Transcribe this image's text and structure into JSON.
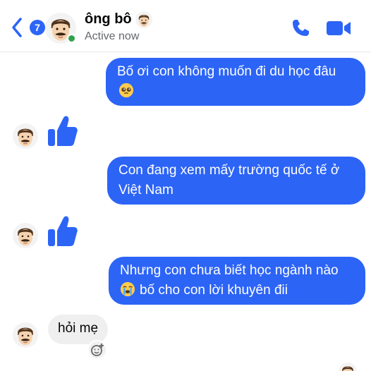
{
  "header": {
    "back_count": "7",
    "contact_name": "ông bô",
    "status": "Active now",
    "icons": {
      "back": "chevron-left-icon",
      "call": "phone-icon",
      "video": "video-camera-icon"
    }
  },
  "messages": [
    {
      "direction": "outgoing",
      "lines": [
        "Bố ơi con không muốn đi du học đâu",
        ""
      ],
      "emoji": "pleading-face-emoji"
    },
    {
      "direction": "incoming",
      "type": "like",
      "icon": "thumbs-up-icon"
    },
    {
      "direction": "outgoing",
      "lines": [
        "Con đang xem mấy trường quốc tế ở",
        "Việt Nam"
      ]
    },
    {
      "direction": "incoming",
      "type": "like",
      "icon": "thumbs-up-icon"
    },
    {
      "direction": "outgoing",
      "lines": [
        "Nhưng con chưa biết học ngành nào",
        "bố cho con lời khuyên đii"
      ],
      "emoji": "loudly-crying-face-emoji"
    },
    {
      "direction": "incoming",
      "lines": [
        "hỏi mẹ"
      ],
      "reaction_icon": "add-reaction-icon"
    }
  ],
  "colors": {
    "accent": "#2c64f6",
    "incoming_bubble": "#efefef",
    "online": "#31a24c",
    "secondary_text": "#65676b"
  }
}
